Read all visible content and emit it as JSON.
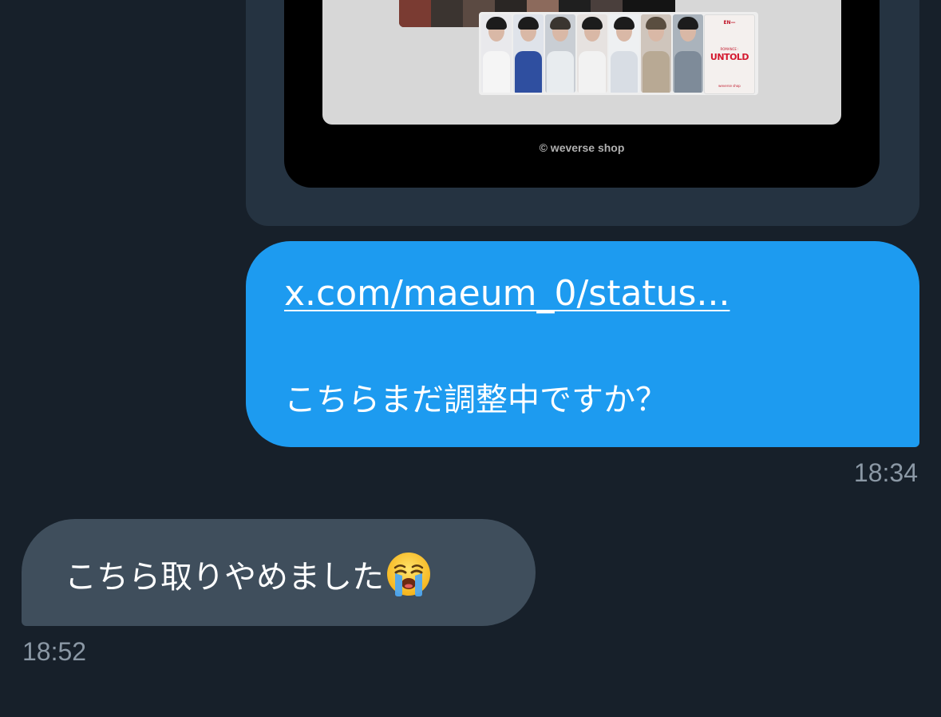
{
  "preview": {
    "copyright": "© weverse shop",
    "album_logo": "EN—",
    "album_subtitle": "ROMANCE :",
    "album_title": "UNTOLD",
    "album_shop": "weverse shop"
  },
  "outgoing": {
    "link": "x.com/maeum_0/status...",
    "message": "こちらまだ調整中ですか？",
    "time": "18:34",
    "bubble_color": "#1d9bf0"
  },
  "incoming": {
    "message": "こちら取りやめました",
    "emoji": "loudly-crying-face-icon",
    "time": "18:52",
    "bubble_color": "#3f4e5c"
  }
}
